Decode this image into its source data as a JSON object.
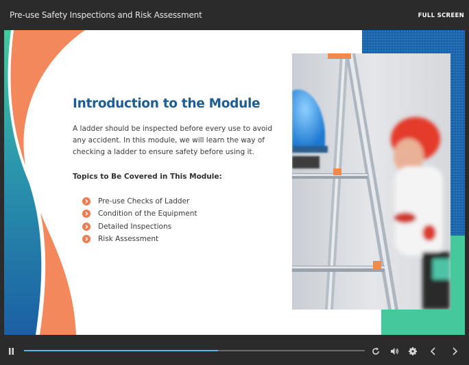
{
  "header": {
    "title": "Pre-use Safety Inspections and Risk Assessment",
    "fullscreen_label": "FULL SCREEN"
  },
  "slide": {
    "heading": "Introduction to the Module",
    "paragraph": "A ladder should be inspected before every use to avoid any accident. In this module, we will learn the way of checking a ladder to ensure safety before using it.",
    "subheading": "Topics to Be Covered in This Module:",
    "topics": [
      "Pre-use Checks of Ladder",
      "Condition of the Equipment",
      "Detailed Inspections",
      "Risk Assessment"
    ]
  },
  "player": {
    "progress": 0.57
  },
  "colors": {
    "accent_orange": "#ee7c53",
    "heading_blue": "#1e5d94",
    "teal": "#45c99c",
    "blue": "#1b6aa8",
    "progress": "#58b6e8"
  },
  "icons": [
    "pause-icon",
    "replay-icon",
    "volume-icon",
    "settings-icon",
    "chevron-left-icon",
    "chevron-right-icon",
    "chevron-right-bullet-icon"
  ]
}
